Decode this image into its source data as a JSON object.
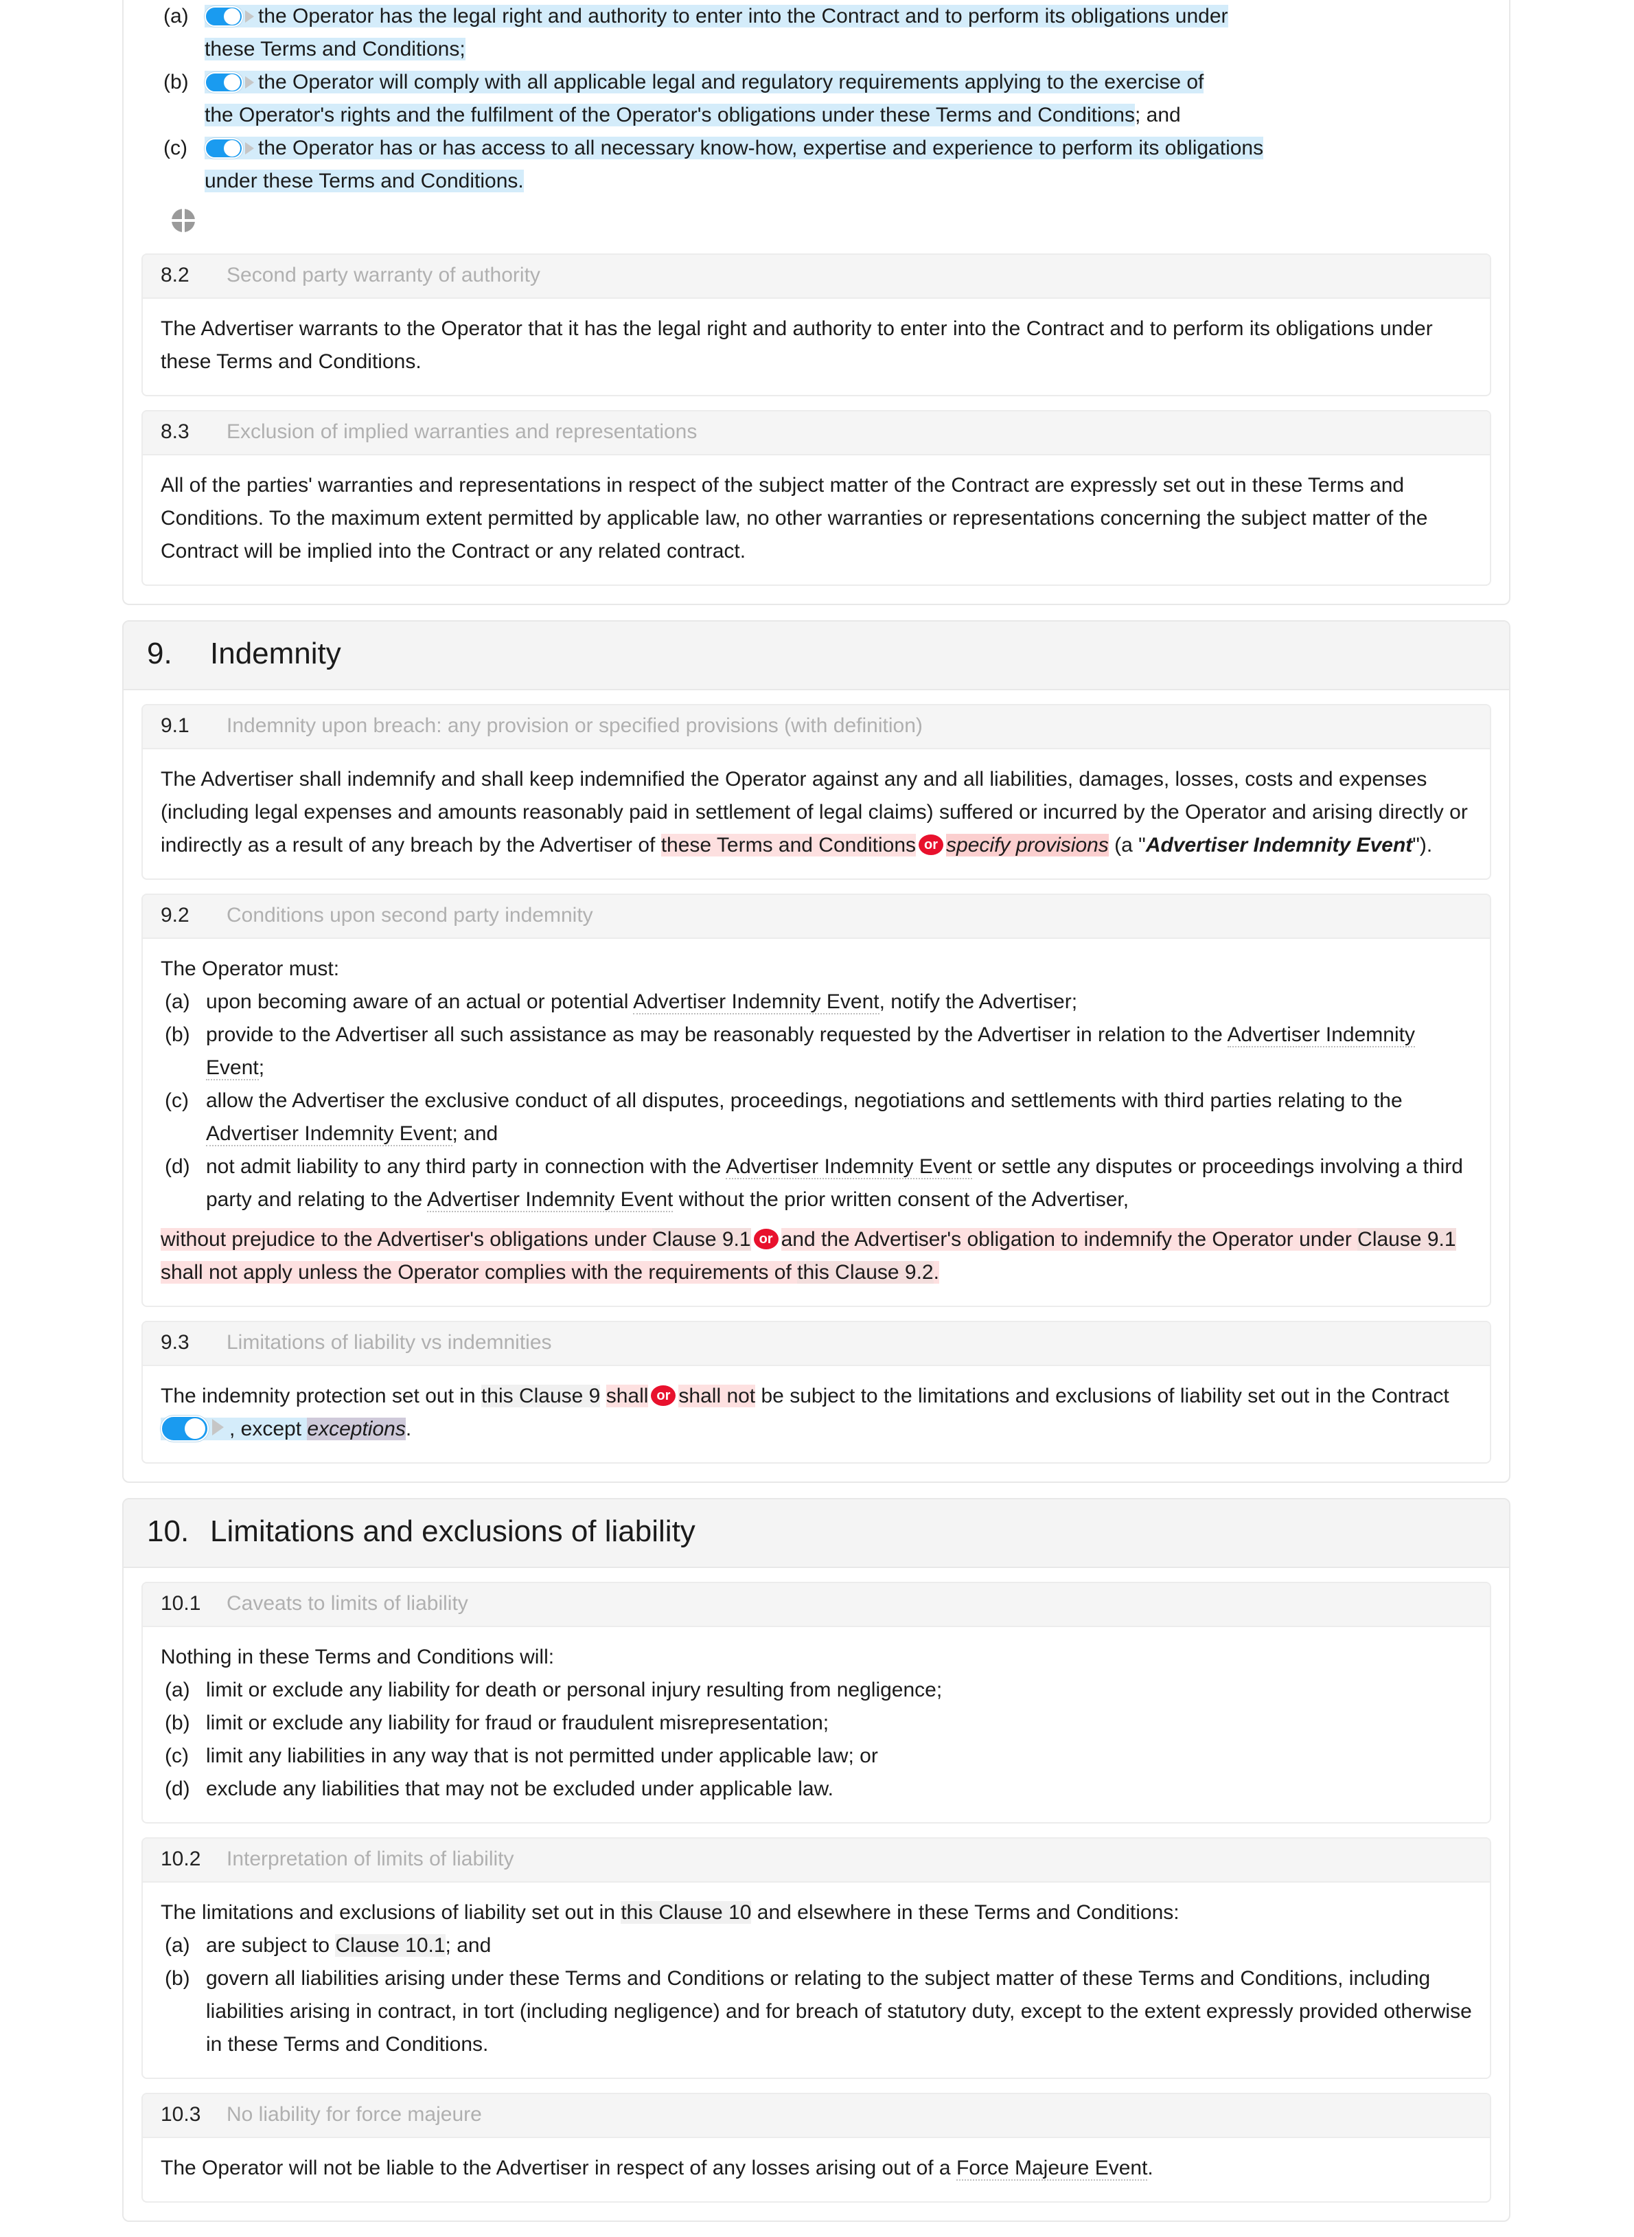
{
  "document": {
    "type": "contract-editor",
    "colors": {
      "toggle_on": "#1a9bf0",
      "or_badge": "#e8112d",
      "optional_highlight": "#d4ecfa",
      "alternative_highlight": "#fde0e0",
      "alternative_selected": "#fbcfcf",
      "crossref_highlight": "#f0f0f0",
      "placeholder_highlight": "#cfcada",
      "clause_header_bg": "#f5f5f5",
      "clause_title_text": "#b0b0b0"
    }
  },
  "clause_8_1_tail": {
    "items": [
      {
        "marker": "(a)",
        "toggle": "on",
        "text": "the Operator has the legal right and authority to enter into the Contract and to perform its obligations under",
        "text_line2": "these Terms and Conditions;"
      },
      {
        "marker": "(b)",
        "toggle": "on",
        "text": "the Operator will comply with all applicable legal and regulatory requirements applying to the exercise of",
        "text_line2": "the Operator's rights and the fulfilment of the Operator's obligations under these Terms and Conditions",
        "text_tail": "; and"
      },
      {
        "marker": "(c)",
        "toggle": "on",
        "text": "the Operator has or has access to all necessary know-how, expertise and experience to perform its obligations",
        "text_line2": "under these Terms and Conditions."
      }
    ],
    "icon": "crosshair-icon"
  },
  "clause_8_2": {
    "number": "8.2",
    "title": "Second party warranty of authority",
    "body": "The Advertiser warrants to the Operator that it has the legal right and authority to enter into the Contract and to perform its obligations under these Terms and Conditions."
  },
  "clause_8_3": {
    "number": "8.3",
    "title": "Exclusion of implied warranties and representations",
    "body": "All of the parties' warranties and representations in respect of the subject matter of the Contract are expressly set out in these Terms and Conditions. To the maximum extent permitted by applicable law, no other warranties or representations concerning the subject matter of the Contract will be implied into the Contract or any related contract."
  },
  "section_9": {
    "number": "9.",
    "title": "Indemnity",
    "clauses": [
      {
        "number": "9.1",
        "title": "Indemnity upon breach: any provision or specified provisions (with definition)",
        "lead": "The Advertiser shall indemnify and shall keep indemnified the Operator against any and all liabilities, damages, losses, costs and expenses (including legal expenses and amounts reasonably paid in settlement of legal claims) suffered or incurred by the Operator and arising directly or indirectly as a result of any breach by the Advertiser of",
        "option_a": "these Terms and Conditions",
        "or_label": "or",
        "option_b": "specify provisions",
        "tail_pre": " (a \"",
        "defined_term": "Advertiser Indemnity Event",
        "tail_post": "\")."
      },
      {
        "number": "9.2",
        "title": "Conditions upon second party indemnity",
        "lead": "The Operator must:",
        "items": [
          {
            "marker": "(a)",
            "pre": "upon becoming aware of an actual or potential ",
            "term": "Advertiser Indemnity Event",
            "post": ", notify the Advertiser;"
          },
          {
            "marker": "(b)",
            "pre": "provide to the Advertiser all such assistance as may be reasonably requested by the Advertiser in relation to the",
            "term": "Advertiser Indemnity Event",
            "post": ";"
          },
          {
            "marker": "(c)",
            "pre": "allow the Advertiser the exclusive conduct of all disputes, proceedings, negotiations and settlements with third parties relating to the ",
            "term": "Advertiser Indemnity Event",
            "post": "; and"
          },
          {
            "marker": "(d)",
            "pre": "not admit liability to any third party in connection with the ",
            "term": "Advertiser Indemnity Event",
            "mid": " or settle any disputes or proceedings involving a third party and relating to the ",
            "term2": "Advertiser Indemnity Event",
            "post": " without the prior written consent of the Advertiser,"
          }
        ],
        "closing_a_pre": "without prejudice to the Advertiser's obligations under ",
        "closing_a_ref": "Clause 9.1",
        "or_label": "or",
        "closing_b_pre": "and the Advertiser's obligation to indemnify the Operator under ",
        "closing_b_ref": "Clause 9.1",
        "closing_b_mid": " shall not apply unless the Operator complies with the requirements of ",
        "closing_b_ref2": "this Clause 9.2",
        "closing_b_post": "."
      },
      {
        "number": "9.3",
        "title": "Limitations of liability vs indemnities",
        "pre": "The indemnity protection set out in ",
        "xref": "this Clause 9",
        "option_a": "shall",
        "or_label": "or",
        "option_b": "shall not",
        "mid": " be subject to the limitations and exclusions of liability set out in the Contract ",
        "toggle": "on",
        "except_label": ", except ",
        "placeholder": "exceptions",
        "post": "."
      }
    ]
  },
  "section_10": {
    "number": "10.",
    "title": "Limitations and exclusions of liability",
    "clauses": [
      {
        "number": "10.1",
        "title": "Caveats to limits of liability",
        "lead": "Nothing in these Terms and Conditions will:",
        "items": [
          {
            "marker": "(a)",
            "text": "limit or exclude any liability for death or personal injury resulting from negligence;"
          },
          {
            "marker": "(b)",
            "text": "limit or exclude any liability for fraud or fraudulent misrepresentation;"
          },
          {
            "marker": "(c)",
            "text": "limit any liabilities in any way that is not permitted under applicable law; or"
          },
          {
            "marker": "(d)",
            "text": "exclude any liabilities that may not be excluded under applicable law."
          }
        ]
      },
      {
        "number": "10.2",
        "title": "Interpretation of limits of liability",
        "lead_pre": "The limitations and exclusions of liability set out in ",
        "lead_xref": "this Clause 10",
        "lead_post": " and elsewhere in these Terms and Conditions:",
        "items": [
          {
            "marker": "(a)",
            "pre": "are subject to ",
            "xref": "Clause 10.1",
            "post": "; and"
          },
          {
            "marker": "(b)",
            "text": "govern all liabilities arising under these Terms and Conditions or relating to the subject matter of these Terms and Conditions, including liabilities arising in contract, in tort (including negligence) and for breach of statutory duty, except to the extent expressly provided otherwise in these Terms and Conditions."
          }
        ]
      },
      {
        "number": "10.3",
        "title": "No liability for force majeure",
        "body_pre": "The Operator will not be liable to the Advertiser in respect of any losses arising out of a ",
        "body_term": "Force Majeure Event",
        "body_post": "."
      }
    ]
  }
}
